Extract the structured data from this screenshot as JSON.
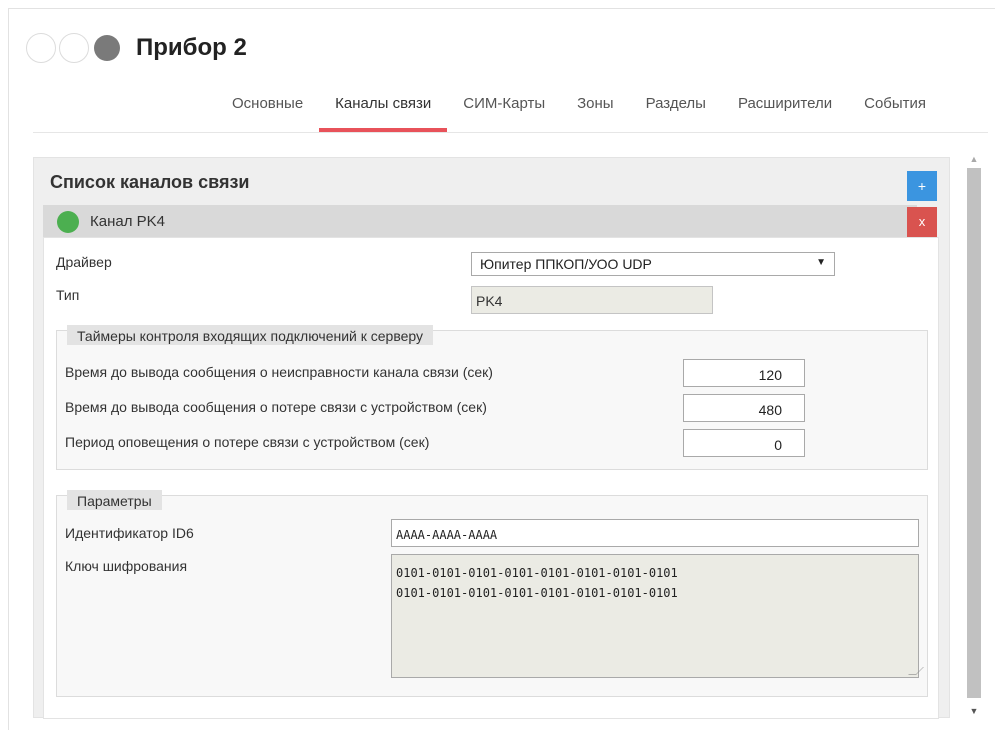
{
  "header": {
    "title": "Прибор 2",
    "status_indicators": [
      "empty-circle",
      "empty-circle",
      "gray-dot"
    ]
  },
  "tabs": [
    {
      "label": "Основные",
      "active": false
    },
    {
      "label": "Каналы связи",
      "active": true
    },
    {
      "label": "СИМ-Карты",
      "active": false
    },
    {
      "label": "Зоны",
      "active": false
    },
    {
      "label": "Разделы",
      "active": false
    },
    {
      "label": "Расширители",
      "active": false
    },
    {
      "label": "События",
      "active": false
    }
  ],
  "panel": {
    "title": "Список каналов связи",
    "add_label": "+",
    "delete_label": "x",
    "channel": {
      "label": "Канал PK4",
      "status_color": "#4caf50"
    }
  },
  "form": {
    "driver_label": "Драйвер",
    "driver_value": "Юпитер ППКОП/УОО UDP",
    "type_label": "Тип",
    "type_value": "PK4"
  },
  "timers": {
    "legend": "Таймеры контроля входящих подключений к серверу",
    "rows": [
      {
        "label": "Время до вывода сообщения о неисправности канала связи (сек)",
        "value": "120"
      },
      {
        "label": "Время до вывода сообщения о потере связи с устройством (сек)",
        "value": "480"
      },
      {
        "label": "Период оповещения о потере связи с устройством (сек)",
        "value": "0"
      }
    ]
  },
  "params": {
    "legend": "Параметры",
    "id_label": "Идентификатор ID6",
    "id_value": "AAAA-AAAA-AAAA",
    "key_label": "Ключ шифрования",
    "key_lines": [
      "0101-0101-0101-0101-0101-0101-0101-0101",
      "0101-0101-0101-0101-0101-0101-0101-0101"
    ]
  },
  "colors": {
    "accent_tab": "#e8525a",
    "add_button": "#3b95e0",
    "delete_button": "#d9534f"
  }
}
